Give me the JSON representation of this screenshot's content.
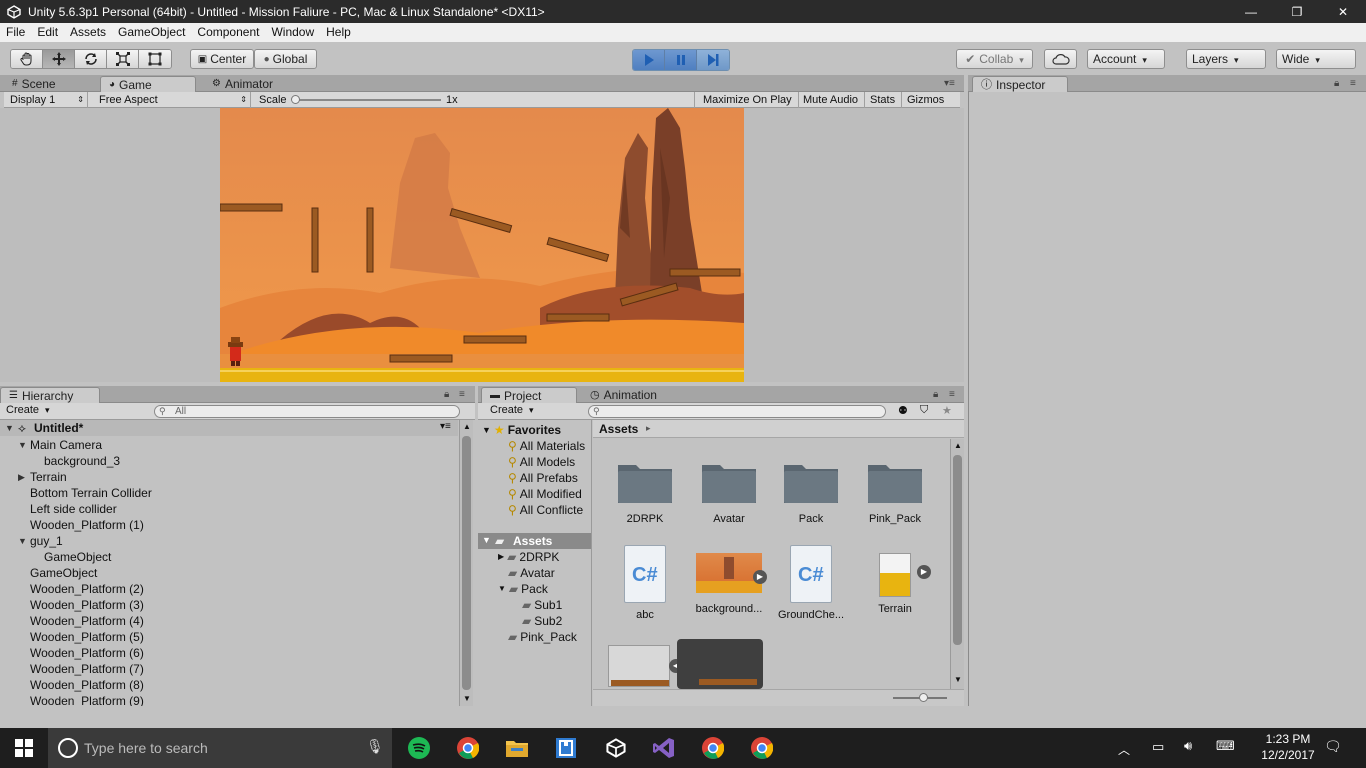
{
  "window": {
    "title": "Unity 5.6.3p1 Personal (64bit) - Untitled - Mission Faliure - PC, Mac & Linux Standalone* <DX11>",
    "minimize": "—",
    "maximize": "❐",
    "close": "✕"
  },
  "menu": [
    "File",
    "Edit",
    "Assets",
    "GameObject",
    "Component",
    "Window",
    "Help"
  ],
  "toolbar": {
    "pivot": "Center",
    "space": "Global",
    "collab": "Collab",
    "account": "Account",
    "layers": "Layers",
    "layout": "Wide"
  },
  "tabs_top": {
    "scene": "Scene",
    "game": "Game",
    "animator": "Animator",
    "inspector": "Inspector"
  },
  "game_toolbar": {
    "display": "Display 1",
    "aspect": "Free Aspect",
    "scale_label": "Scale",
    "scale_value": "1x",
    "scale_fraction": 0.0,
    "maximize": "Maximize On Play",
    "mute": "Mute Audio",
    "stats": "Stats",
    "gizmos": "Gizmos"
  },
  "hierarchy": {
    "tab": "Hierarchy",
    "create": "Create",
    "search_placeholder": "All",
    "scene": "Untitled*",
    "items": [
      "Main Camera",
      "background_3",
      "Terrain",
      "Bottom Terrain Collider",
      "Left side collider",
      "Wooden_Platform (1)",
      "guy_1",
      "GameObject",
      "GameObject",
      "Wooden_Platform (2)",
      "Wooden_Platform (3)",
      "Wooden_Platform (4)",
      "Wooden_Platform (5)",
      "Wooden_Platform (6)",
      "Wooden_Platform (7)",
      "Wooden_Platform (8)",
      "Wooden_Platform (9)"
    ]
  },
  "project": {
    "tab": "Project",
    "tab2": "Animation",
    "create": "Create",
    "favorites_label": "Favorites",
    "favorites": [
      "All Materials",
      "All Models",
      "All Prefabs",
      "All Modified",
      "All Conflicte"
    ],
    "assets_label": "Assets",
    "folders": [
      "2DRPK",
      "Avatar",
      "Pack",
      "Sub1",
      "Sub2",
      "Pink_Pack"
    ],
    "breadcrumb": "Assets",
    "grid": [
      "2DRPK",
      "Avatar",
      "Pack",
      "Pink_Pack",
      "abc",
      "background...",
      "GroundChe...",
      "Terrain"
    ],
    "csharp": "C#"
  },
  "taskbar": {
    "search_placeholder": "Type here to search",
    "time": "1:23 PM",
    "date": "12/2/2017"
  },
  "colors": {
    "play_blue": "#1f5fb3",
    "sky": "#e8894a",
    "sand": "#f08a2a",
    "ground": "#e8b410"
  }
}
